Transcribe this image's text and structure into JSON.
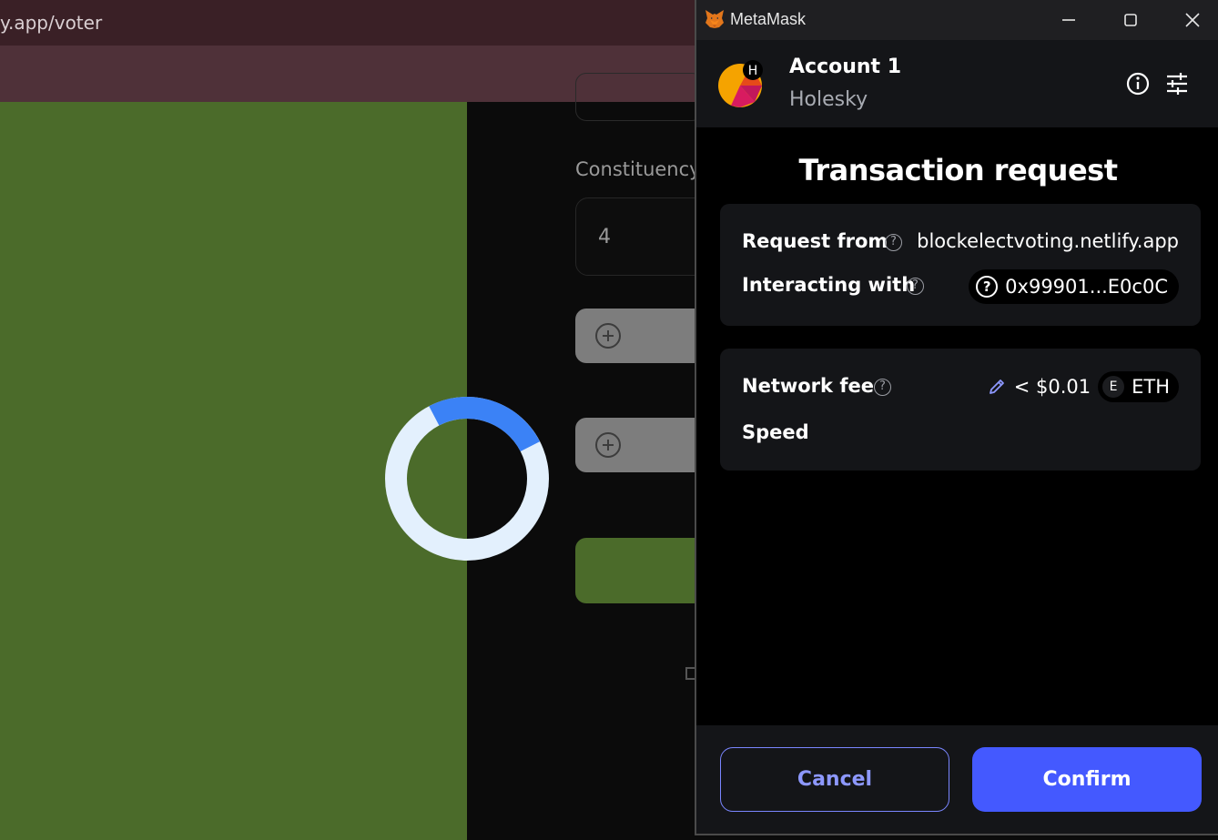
{
  "browser": {
    "url": "y.app/voter"
  },
  "voter_page": {
    "constituency_label": "Constituency",
    "constituency_value": "4"
  },
  "metamask": {
    "window_title": "MetaMask",
    "account": {
      "name": "Account 1",
      "network": "Holesky",
      "network_badge": "H"
    },
    "title": "Transaction request",
    "request_from": {
      "label": "Request from",
      "value": "blockelectvoting.netlify.app"
    },
    "interacting_with": {
      "label": "Interacting with",
      "address": "0x99901...E0c0C"
    },
    "network_fee": {
      "label": "Network fee",
      "value": "< $0.01",
      "token_badge": "E",
      "token": "ETH"
    },
    "speed": {
      "label": "Speed"
    },
    "buttons": {
      "cancel": "Cancel",
      "confirm": "Confirm"
    }
  },
  "colors": {
    "accent": "#4459ff",
    "page_green": "#4b6b2a",
    "spinner_track": "#e3f0fd",
    "spinner_arc": "#3b82f6"
  }
}
